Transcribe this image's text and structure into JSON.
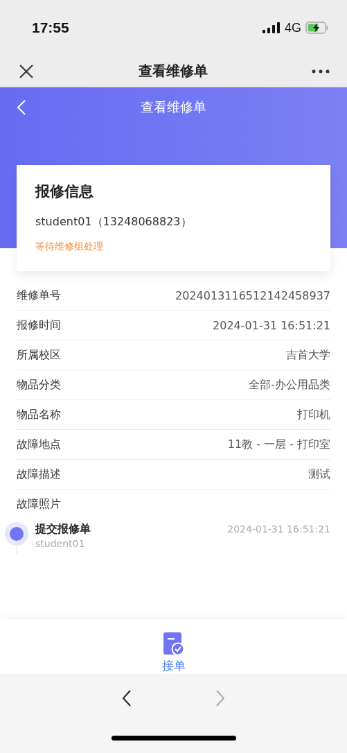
{
  "status_bar": {
    "time": "17:55",
    "network": "4G"
  },
  "browser_header": {
    "title": "查看维修单"
  },
  "page_header": {
    "title": "查看维修单"
  },
  "card": {
    "title": "报修信息",
    "contact": "student01（13248068823）",
    "status": "等待维修组处理"
  },
  "details": [
    {
      "label": "维修单号",
      "value": "2024013116512142458937"
    },
    {
      "label": "报修时间",
      "value": "2024-01-31 16:51:21"
    },
    {
      "label": "所属校区",
      "value": "吉首大学"
    },
    {
      "label": "物品分类",
      "value": "全部-办公用品类"
    },
    {
      "label": "物品名称",
      "value": "打印机"
    },
    {
      "label": "故障地点",
      "value": "11教 - 一层 - 打印室"
    },
    {
      "label": "故障描述",
      "value": "测试"
    },
    {
      "label": "故障照片"
    }
  ],
  "timeline": [
    {
      "title": "提交报修单",
      "user": "student01",
      "time": "2024-01-31 16:51:21"
    }
  ],
  "action": {
    "label": "接单"
  },
  "browser_nav": {
    "back_disabled": false,
    "forward_disabled": true
  }
}
